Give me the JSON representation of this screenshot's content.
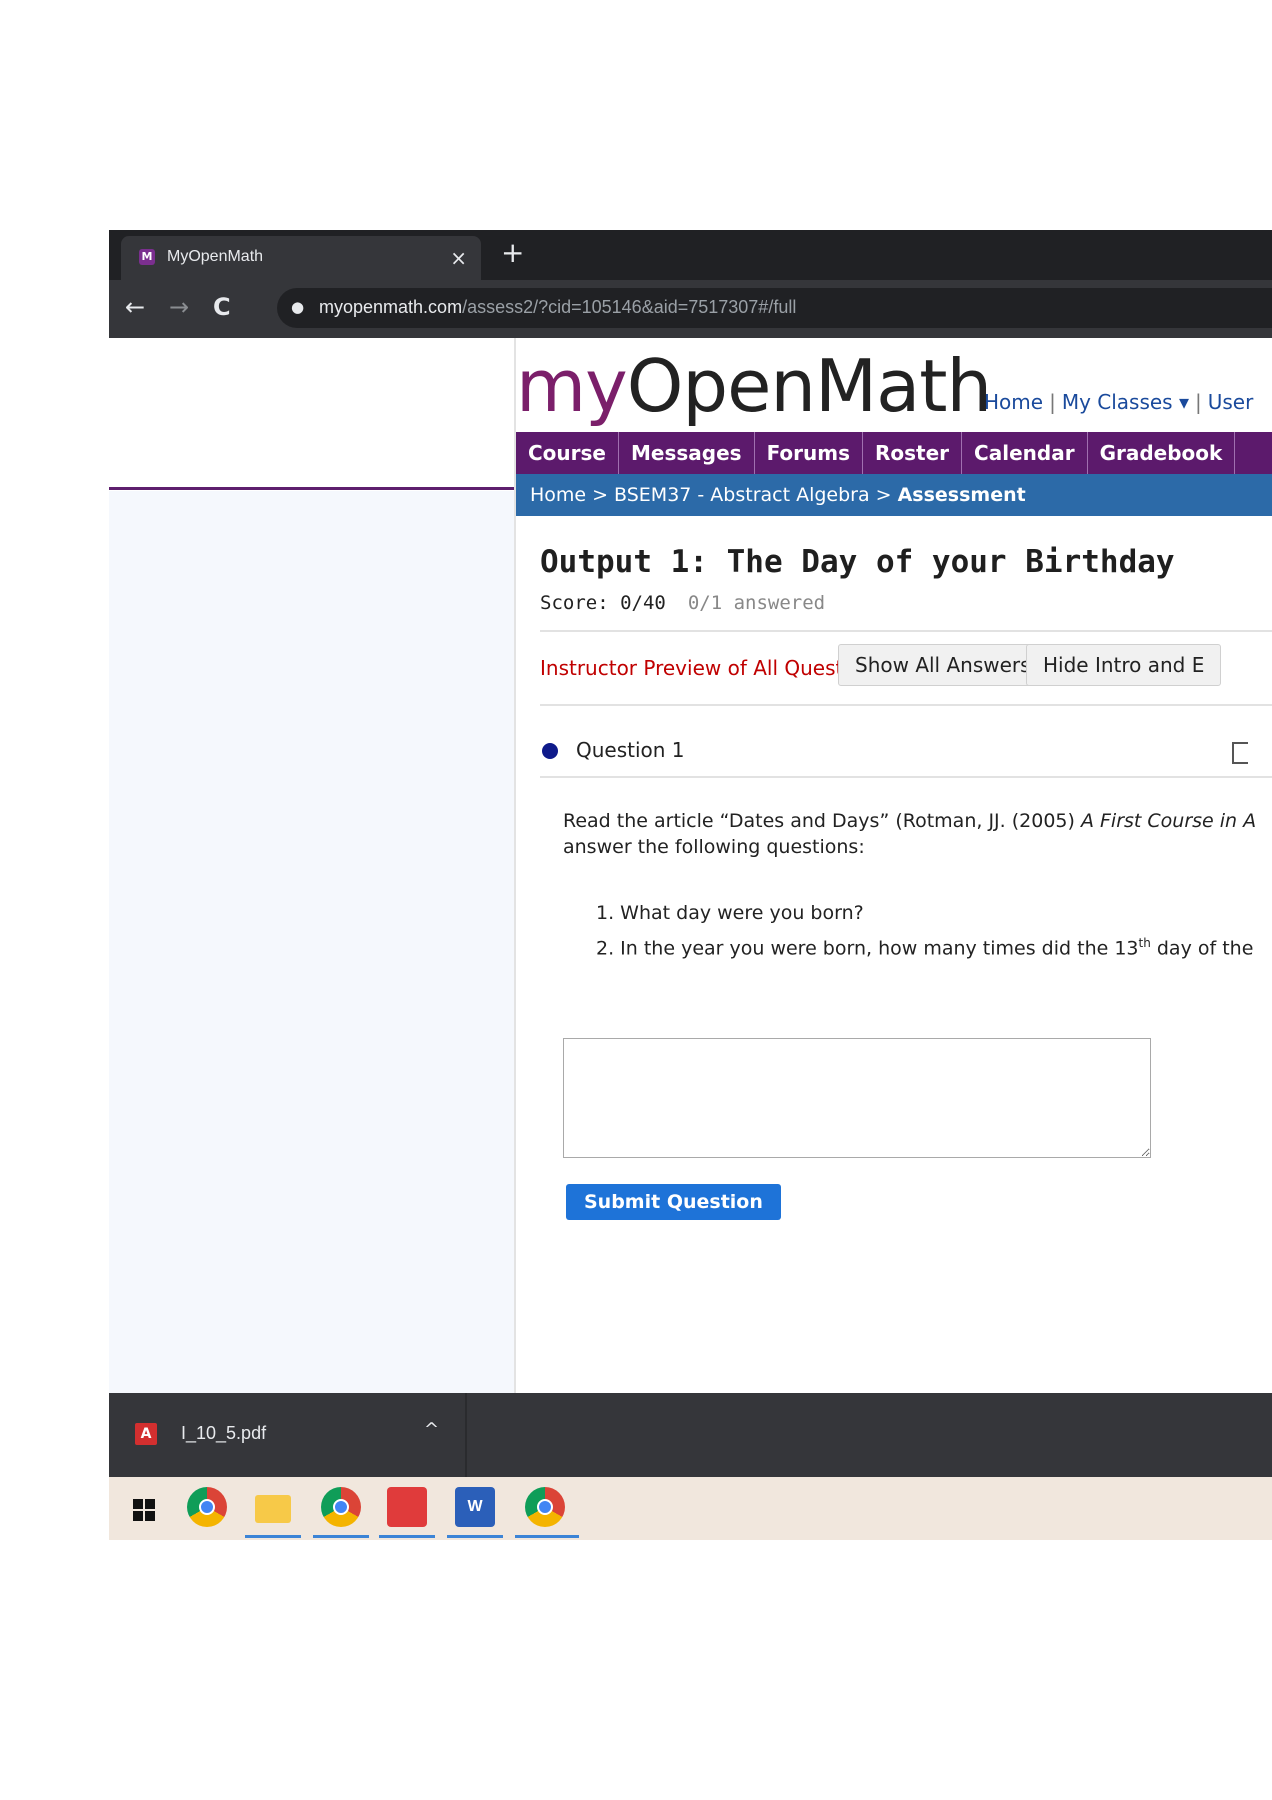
{
  "browser": {
    "tab_title": "MyOpenMath",
    "tab_close": "×",
    "new_tab": "+",
    "url_host": "myopenmath.com",
    "url_path": "/assess2/?cid=105146&aid=7517307#/full",
    "back": "←",
    "forward": "→",
    "reload": "C",
    "lock": "🔒"
  },
  "site": {
    "logo_my": "my",
    "logo_rest": "OpenMath",
    "toplinks": {
      "home": "Home",
      "sep": "|",
      "my_classes": "My Classes ▾",
      "user": "User"
    },
    "nav": [
      "Course",
      "Messages",
      "Forums",
      "Roster",
      "Calendar",
      "Gradebook"
    ],
    "breadcrumb": {
      "home": "Home",
      "sep": ">",
      "course": "BSEM37 - Abstract Algebra",
      "current": "Assessment"
    }
  },
  "assessment": {
    "title": "Output 1: The Day of your Birthday",
    "score": "Score: 0/40",
    "answered": "0/1 answered",
    "preview_label": "Instructor Preview of All Questions",
    "show_all_answers": "Show All Answers",
    "hide_intro": "Hide Intro and E",
    "question_label": "Question 1",
    "question_text_1": "Read the article “Dates and Days” (Rotman, JJ. (2005) ",
    "question_text_italic": "A First Course in A",
    "question_text_2": "answer the following questions:",
    "item1": "1. What day were you born?",
    "item2_pre": "2. In the year you were born, how many times did the 13",
    "item2_sup": "th",
    "item2_post": " day of the",
    "answer_value": "",
    "submit": "Submit Question"
  },
  "downloads": {
    "file": "I_10_5.pdf",
    "caret": "^"
  },
  "taskbar": {
    "apps": [
      "start-icon",
      "chrome-icon",
      "file-explorer-icon",
      "chrome-profile-icon",
      "acrobat-icon",
      "word-icon",
      "chrome-profile-2-icon"
    ]
  },
  "colors": {
    "purple_nav": "#5c1a6c",
    "breadcrumb_blue": "#2c6aa8",
    "preview_red": "#c00000",
    "submit_blue": "#1e73d8",
    "question_dot": "#0e1a8a"
  }
}
